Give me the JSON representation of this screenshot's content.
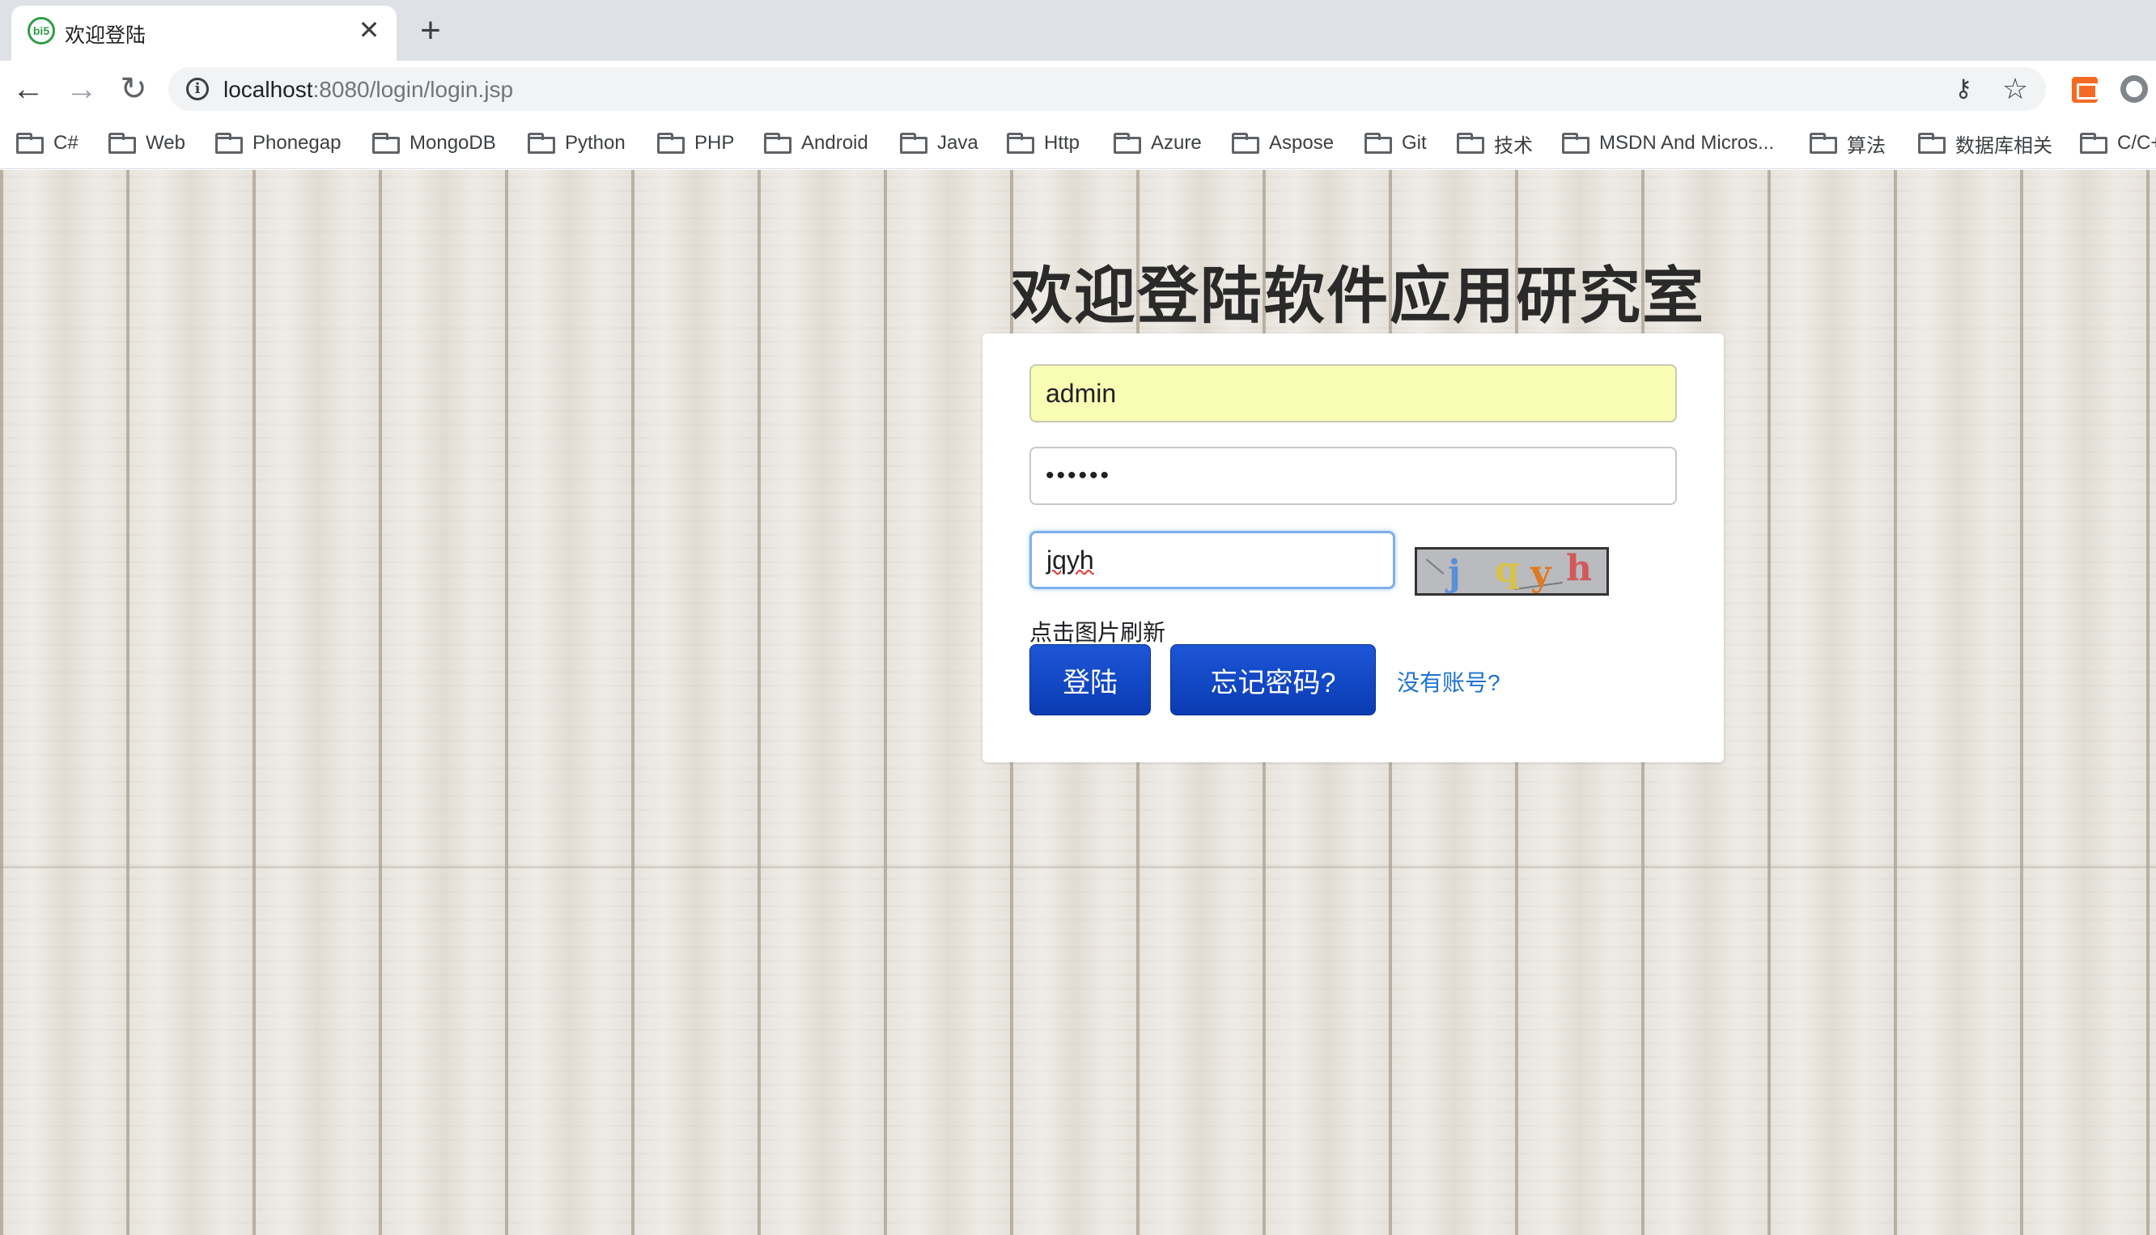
{
  "browser": {
    "tab": {
      "title": "欢迎登陆",
      "favicon": "bi5",
      "close": "✕"
    },
    "new_tab": "+",
    "url": {
      "host": "localhost",
      "rest": ":8080/login/login.jsp"
    },
    "bookmarks": [
      {
        "label": "C#"
      },
      {
        "label": "Web"
      },
      {
        "label": "Phonegap"
      },
      {
        "label": "MongoDB"
      },
      {
        "label": "Python"
      },
      {
        "label": "PHP"
      },
      {
        "label": "Android"
      },
      {
        "label": "Java"
      },
      {
        "label": "Http"
      },
      {
        "label": "Azure"
      },
      {
        "label": "Aspose"
      },
      {
        "label": "Git"
      },
      {
        "label": "技术"
      },
      {
        "label": "MSDN And Micros..."
      },
      {
        "label": "算法"
      },
      {
        "label": "数据库相关"
      },
      {
        "label": "C/C+"
      }
    ]
  },
  "login": {
    "title": "欢迎登陆软件应用研究室",
    "username": "admin",
    "password_mask": "••••••",
    "captcha_input": "jqyh",
    "captcha_chars": [
      "j",
      "q",
      "y",
      "h"
    ],
    "refresh_hint": "点击图片刷新",
    "login_button": "登陆",
    "forgot_button": "忘记密码?",
    "register_link": "没有账号?"
  },
  "colors": {
    "button": "#1048c8",
    "link": "#1e73d2",
    "autofill": "#fafdb4",
    "focus": "#7fb0ea"
  }
}
